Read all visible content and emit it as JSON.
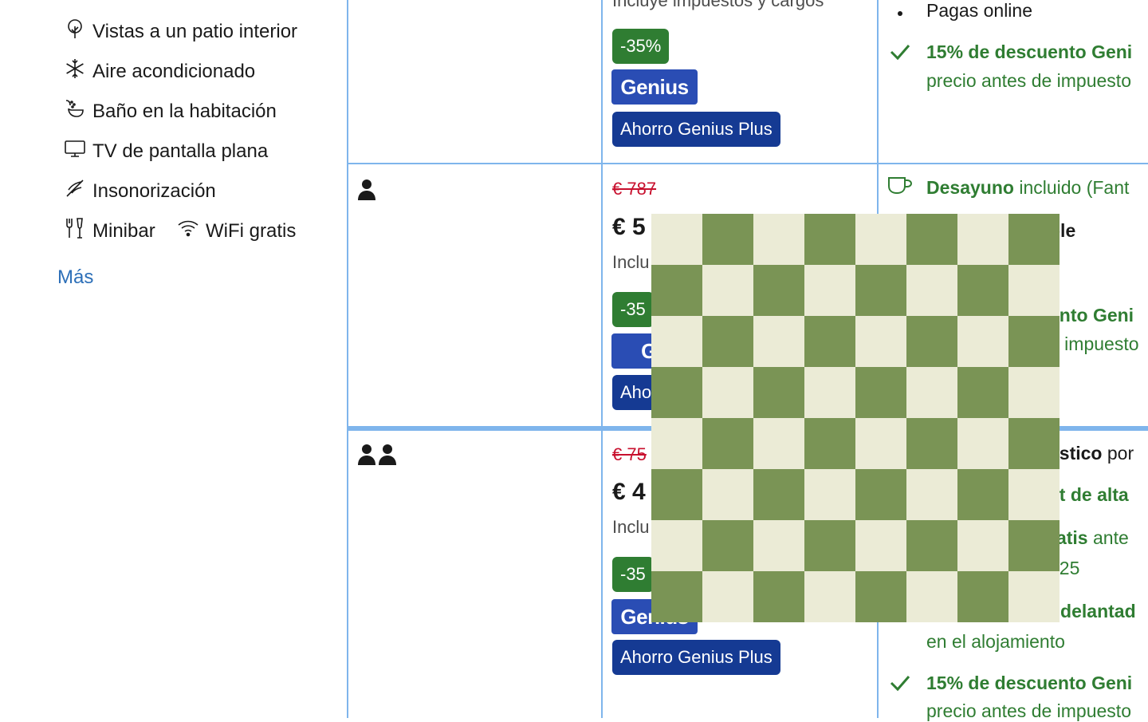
{
  "amenities": [
    {
      "icon": "tree-icon",
      "label": "Vistas a un patio interior"
    },
    {
      "icon": "snowflake-icon",
      "label": "Aire acondicionado"
    },
    {
      "icon": "bath-icon",
      "label": "Baño en la habitación"
    },
    {
      "icon": "tv-icon",
      "label": "TV de pantalla plana"
    },
    {
      "icon": "soundproof-icon",
      "label": "Insonorización"
    },
    {
      "icon": "minibar-icon",
      "label": "Minibar"
    },
    {
      "icon": "wifi-icon",
      "label": "WiFi gratis"
    }
  ],
  "more_link": "Más",
  "row0": {
    "incl_partial": "Incluye impuestos y cargos",
    "discount_badge": "-35%",
    "genius_badge": "Genius",
    "plus_badge": "Ahorro Genius Plus",
    "bullet_text": "Pagas online",
    "genius_discount_title": "15% de descuento Geni",
    "genius_discount_sub": "precio antes de impuesto"
  },
  "row1": {
    "old_price": "€ 787",
    "new_price_partial": "€ 5",
    "incl_partial": "Inclu",
    "discount_partial": "-35",
    "genius_partial": "Ge",
    "plus_partial": "Aho",
    "breakfast_bold": "Desayuno",
    "breakfast_rest": " incluido (Fant",
    "cond2_partial": "ble",
    "genius_discount_partial": "ento Geni",
    "genius_sub_partial": "e impuesto"
  },
  "row2": {
    "old_price_partial": "€ 75",
    "new_price_partial": "€ 4",
    "incl_partial": "Inclu",
    "discount_partial": "-35",
    "genius_partial": "Genius",
    "plus_badge": "Ahorro Genius Plus",
    "cond1_bold": "ástico",
    "cond1_rest": " por",
    "cond2_partial": "et de alta",
    "cond3_bold": "ratis",
    "cond3_rest": " ante",
    "cond3_sub": "025",
    "cond4_partial": "ndelantad",
    "cond4_sub": "en el alojamiento",
    "genius_discount_title": "15% de descuento Geni",
    "genius_discount_sub": "precio antes de impuesto"
  },
  "colors": {
    "grid_line": "#7fb5ec",
    "green": "#2f7d32",
    "genius_blue": "#2a4db4",
    "plus_blue": "#153a93",
    "strike_red": "#c8102e",
    "link_blue": "#2c6fb8",
    "checker_dark": "#7a9455",
    "checker_light": "#ebebd6"
  }
}
